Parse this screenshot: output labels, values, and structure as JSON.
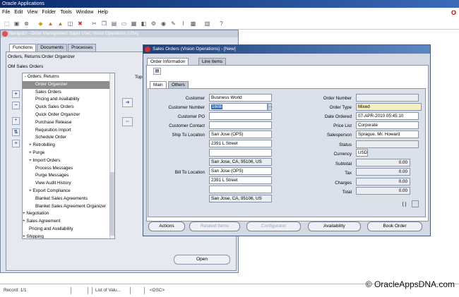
{
  "app": {
    "title": "Oracle Applications"
  },
  "menu": [
    "File",
    "Edit",
    "View",
    "Folder",
    "Tools",
    "Window",
    "Help"
  ],
  "navigator": {
    "title": "Navigator - Order Management Super User, Vision Operations (USA)",
    "tabs": [
      "Functions",
      "Documents",
      "Processes"
    ],
    "heading": "Orders, Returns:Order Organizer",
    "responsibility": "OM Sales Orders",
    "top_label": "Top",
    "open_button": "Open",
    "tree": [
      "-  Orders, Returns",
      "Order Organizer",
      "Sales Orders",
      "Pricing and Availability",
      "Quick Sales Orders",
      "Quick Order Organizer",
      "Purchase Release",
      "Requisition Import",
      "Schedule Order",
      "+  Retrobilling",
      "+  Purge",
      "+  Import Orders",
      "Process Messages",
      "Purge Messages",
      "View Audit History",
      "+  Export Compliance",
      "Blanket Sales Agreements",
      "Blanket Sales Agreement Organizer",
      "+  Negotiation",
      "+  Sales Agreement",
      "Pricing and Availability",
      "+  Shipping"
    ]
  },
  "sales_order": {
    "title": "Sales Orders (Vision Operations) - [New]",
    "tabs": [
      "Order Information",
      "Line Items"
    ],
    "subtabs": [
      "Main",
      "Others"
    ],
    "left": {
      "customer": {
        "label": "Customer",
        "value": "Business World"
      },
      "customer_number": {
        "label": "Customer Number",
        "value": "1608"
      },
      "customer_po": {
        "label": "Customer PO",
        "value": ""
      },
      "customer_contact": {
        "label": "Customer Contact",
        "value": ""
      },
      "ship_to": {
        "label": "Ship To Location",
        "lines": [
          "San Jose (OPS)",
          "2391 L Street",
          "",
          "San Jose, CA, 95106, US"
        ]
      },
      "bill_to": {
        "label": "Bill To Location",
        "lines": [
          "San Jose (OPS)",
          "2391 L Street",
          "",
          "San Jose, CA, 95106, US"
        ]
      }
    },
    "right": {
      "order_number": {
        "label": "Order Number",
        "value": ""
      },
      "order_type": {
        "label": "Order Type",
        "value": "Mixed"
      },
      "date_ordered": {
        "label": "Date Ordered",
        "value": "07-APR-2010 05:45:10"
      },
      "price_list": {
        "label": "Price List",
        "value": "Corporate"
      },
      "salesperson": {
        "label": "Salesperson",
        "value": "Sprague, Mr. Howard"
      },
      "status": {
        "label": "Status",
        "value": ""
      },
      "currency": {
        "label": "Currency",
        "value": "USD"
      },
      "subtotal": {
        "label": "Subtotal",
        "value": "0.00"
      },
      "tax": {
        "label": "Tax",
        "value": "0.00"
      },
      "charges": {
        "label": "Charges",
        "value": "0.00"
      },
      "total": {
        "label": "Total",
        "value": "0.00"
      }
    },
    "bracket_text": "[ ]",
    "buttons": {
      "actions": "Actions",
      "related_items": "Related Items",
      "configurator": "Configurator",
      "availability": "Availability",
      "book_order": "Book Order"
    }
  },
  "status_bar": {
    "record": "Record: 1/1",
    "lov": "List of Valu...",
    "osc": "<OSC>"
  },
  "watermark": "© OracleAppsDNA.com",
  "colors": {
    "title_bar": "#1d3f7a",
    "required_field": "#f8f0bc",
    "selected_row": "#8d8d8d"
  }
}
